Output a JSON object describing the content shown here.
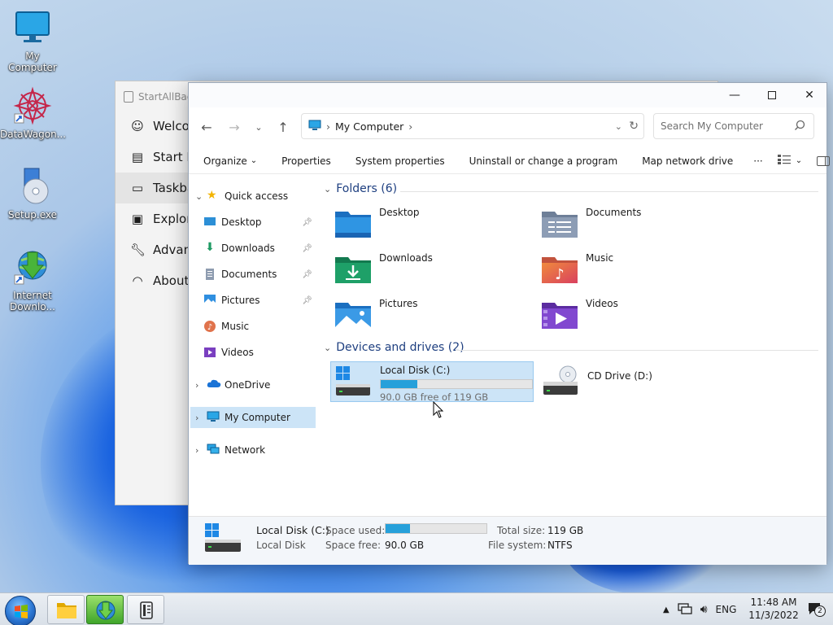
{
  "desktop": {
    "icons": [
      {
        "label": "My Computer"
      },
      {
        "label": "DataWagon..."
      },
      {
        "label": "Setup.exe"
      },
      {
        "label": "Internet Downlo..."
      }
    ]
  },
  "startallback": {
    "title": "StartAllBack",
    "items": [
      {
        "label": "Welcome",
        "icon": "smile-icon"
      },
      {
        "label": "Start Menu",
        "icon": "start-menu-icon"
      },
      {
        "label": "Taskbar",
        "icon": "taskbar-icon"
      },
      {
        "label": "Explorer",
        "icon": "explorer-icon"
      },
      {
        "label": "Advanced",
        "icon": "wrench-icon"
      },
      {
        "label": "About",
        "icon": "gauge-icon"
      }
    ]
  },
  "window": {
    "address": {
      "location": "My Computer"
    },
    "search": {
      "placeholder": "Search My Computer"
    },
    "toolbar": {
      "organize": "Organize",
      "properties": "Properties",
      "system_properties": "System properties",
      "uninstall": "Uninstall or change a program",
      "map_drive": "Map network drive",
      "more": "···"
    },
    "sidebar": {
      "quick_access": "Quick access",
      "items": {
        "desktop": "Desktop",
        "downloads": "Downloads",
        "documents": "Documents",
        "pictures": "Pictures",
        "music": "Music",
        "videos": "Videos"
      },
      "onedrive": "OneDrive",
      "my_computer": "My Computer",
      "network": "Network"
    },
    "folders": {
      "header": "Folders (6)",
      "items": [
        "Desktop",
        "Documents",
        "Downloads",
        "Music",
        "Pictures",
        "Videos"
      ]
    },
    "drives": {
      "header": "Devices and drives (2)",
      "c": {
        "name": "Local Disk (C:)",
        "free_text": "90.0 GB free of 119 GB",
        "used_fraction": 0.244
      },
      "d": {
        "name": "CD Drive (D:)"
      }
    },
    "details": {
      "name": "Local Disk (C:)",
      "type": "Local Disk",
      "space_used_label": "Space used:",
      "space_free_label": "Space free:",
      "space_free": "90.0 GB",
      "total_size_label": "Total size:",
      "total_size": "119 GB",
      "file_system_label": "File system:",
      "file_system": "NTFS",
      "used_fraction": 0.244
    }
  },
  "taskbar": {
    "lang": "ENG",
    "time": "11:48 AM",
    "date": "11/3/2022",
    "notifications": "2"
  }
}
